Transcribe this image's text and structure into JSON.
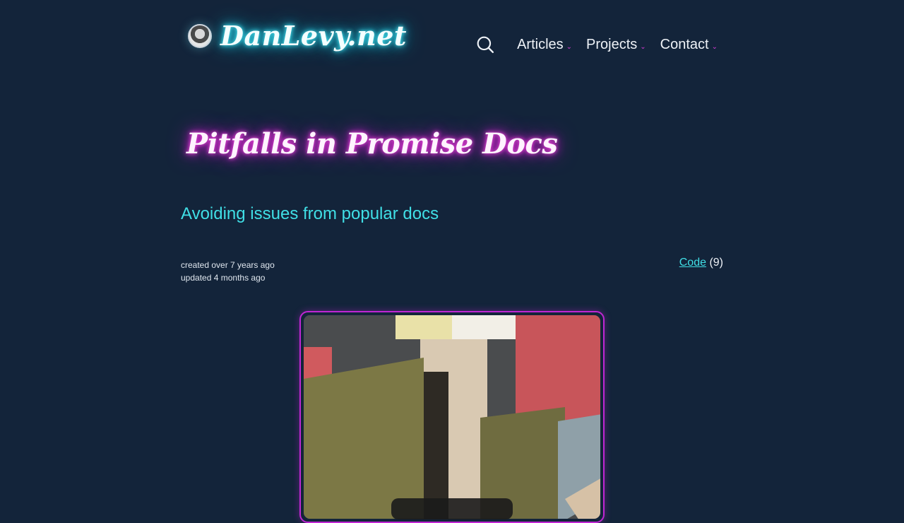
{
  "site": {
    "logo_text": "DanLevy.net"
  },
  "nav": {
    "items": [
      {
        "label": "Articles"
      },
      {
        "label": "Projects"
      },
      {
        "label": "Contact"
      }
    ]
  },
  "post": {
    "title": "Pitfalls in Promise Docs",
    "subtitle": "Avoiding issues from popular docs",
    "created": "created over 7 years ago",
    "updated": "updated 4 months ago",
    "tag_label": "Code",
    "tag_count": "(9)"
  },
  "colors": {
    "background": "#13243a",
    "logo_glow": "#22d3ee",
    "title_glow": "#e11dde",
    "accent": "#40dfe6",
    "frame_border": "#c026d3"
  }
}
